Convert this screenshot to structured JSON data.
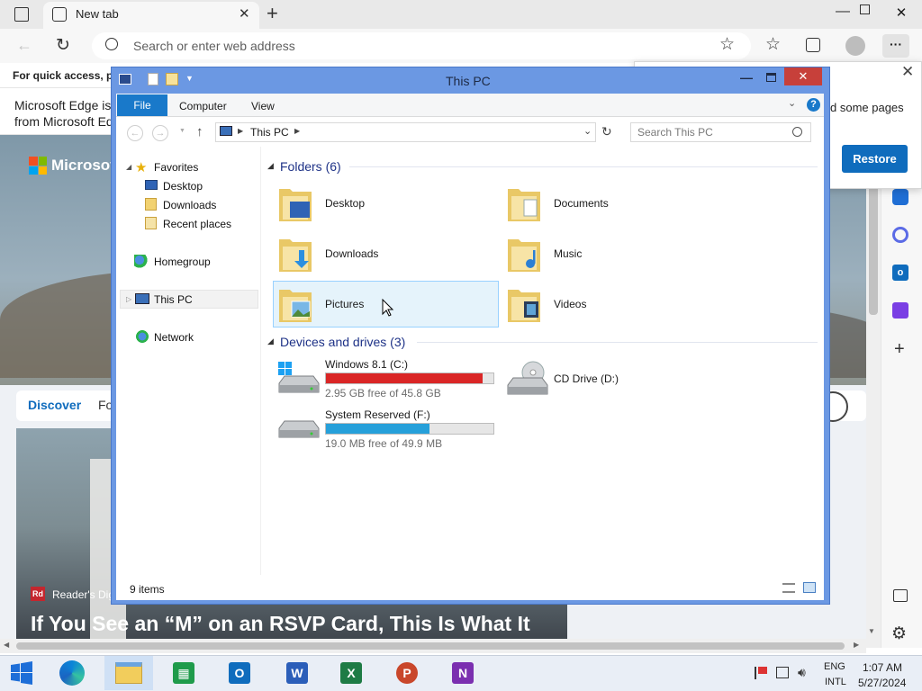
{
  "browser": {
    "tab_title": "New tab",
    "address_placeholder": "Search or enter web address",
    "info_bar": "For quick access, pla",
    "notice_line1": "Microsoft Edge is r",
    "notice_line2": "from Microsoft Edg",
    "brand": "Microsof",
    "popup_text": "d some pages",
    "restore_label": "Restore",
    "feed_tab_active": "Discover",
    "feed_tab_next": "Fo",
    "card_source": "Reader's Dig",
    "card_headline": "If You See an “M” on an RSVP Card, This Is What It",
    "accent": "#0f6cbd"
  },
  "explorer": {
    "title": "This PC",
    "ribbon_tabs": [
      "File",
      "Computer",
      "View"
    ],
    "breadcrumb": "This PC",
    "search_placeholder": "Search This PC",
    "nav": {
      "favorites": "Favorites",
      "desktop": "Desktop",
      "downloads": "Downloads",
      "recent": "Recent places",
      "homegroup": "Homegroup",
      "thispc": "This PC",
      "network": "Network"
    },
    "folders_header": "Folders (6)",
    "folders": [
      "Desktop",
      "Documents",
      "Downloads",
      "Music",
      "Pictures",
      "Videos"
    ],
    "drives_header": "Devices and drives (3)",
    "drives": [
      {
        "name": "Windows 8.1 (C:)",
        "free": "2.95 GB free of 45.8 GB",
        "used_fraction": 0.936,
        "color": "#da2626"
      },
      {
        "name": "CD Drive (D:)"
      },
      {
        "name": "System Reserved (F:)",
        "free": "19.0 MB free of 49.9 MB",
        "used_fraction": 0.62,
        "color": "#26a0da"
      }
    ],
    "status": "9 items"
  },
  "taskbar": {
    "time": "1:07 AM",
    "date": "5/27/2024",
    "lang1": "ENG",
    "lang2": "INTL"
  }
}
